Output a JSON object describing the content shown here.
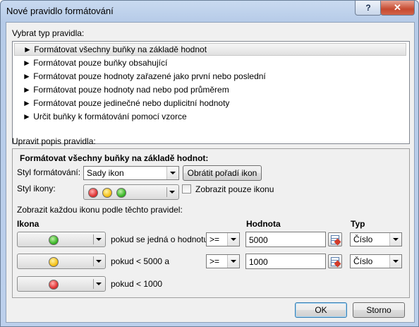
{
  "window": {
    "title": "Nové pravidlo formátování",
    "help_label": "?",
    "close_label": "✕"
  },
  "rule_type": {
    "label": "Vybrat typ pravidla:",
    "items": [
      "► Formátovat všechny buňky na základě hodnot",
      "► Formátovat pouze buňky obsahující",
      "► Formátovat pouze hodnoty zařazené jako první nebo poslední",
      "► Formátovat pouze hodnoty nad nebo pod průměrem",
      "► Formátovat pouze jedinečné nebo duplicitní hodnoty",
      "► Určit buňky k formátování pomocí vzorce"
    ],
    "selected_index": 0
  },
  "description": {
    "label": "Upravit popis pravidla:",
    "heading": "Formátovat všechny buňky na základě hodnot:",
    "format_style_label": "Styl formátování:",
    "format_style_value": "Sady ikon",
    "reverse_button": "Obrátit pořadí ikon",
    "icon_style_label": "Styl ikony:",
    "icon_style_colors": [
      "red",
      "yellow",
      "green"
    ],
    "show_icon_only_label": "Zobrazit pouze ikonu",
    "show_icon_only_checked": false,
    "rules_intro": "Zobrazit každou ikonu podle těchto pravidel:",
    "col_icon": "Ikona",
    "col_value": "Hodnota",
    "col_type": "Typ",
    "rows": [
      {
        "icon": "green",
        "condition": "pokud se jedná o hodnotu",
        "operator": ">=",
        "value": "5000",
        "type": "Číslo"
      },
      {
        "icon": "yellow",
        "condition": "pokud < 5000 a",
        "operator": ">=",
        "value": "1000",
        "type": "Číslo"
      },
      {
        "icon": "red",
        "condition": "pokud < 1000"
      }
    ]
  },
  "buttons": {
    "ok": "OK",
    "cancel": "Storno"
  },
  "colors": {
    "title_bar": "#b6cbe8",
    "close_button": "#c64a30",
    "dialog_bg": "#f0f0f0",
    "default_button_border": "#3c7fb1"
  }
}
